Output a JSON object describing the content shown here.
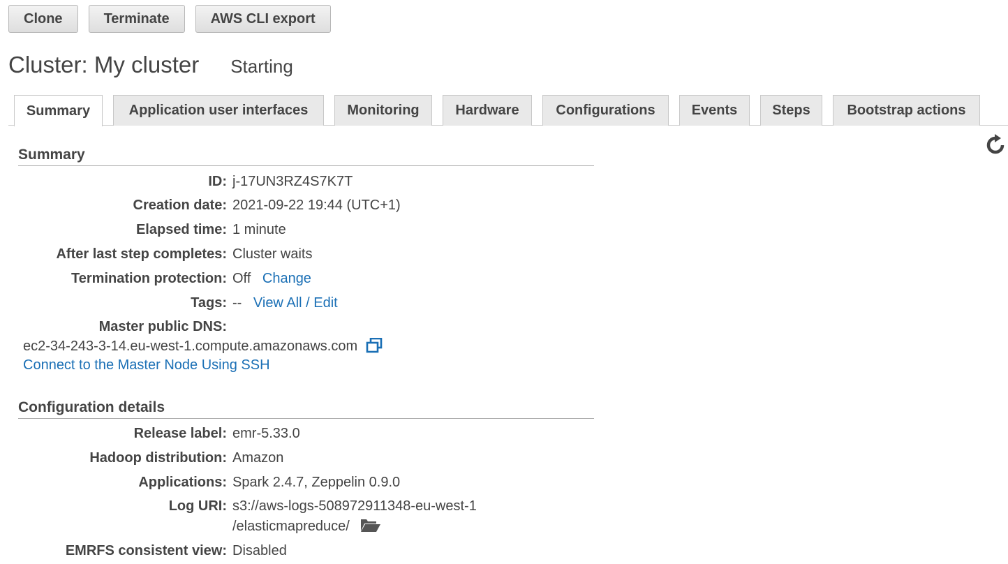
{
  "toolbar": {
    "clone": "Clone",
    "terminate": "Terminate",
    "cli_export": "AWS CLI export"
  },
  "cluster": {
    "title": "Cluster: My cluster",
    "status": "Starting"
  },
  "tabs": [
    {
      "label": "Summary",
      "active": true
    },
    {
      "label": "Application user interfaces",
      "active": false
    },
    {
      "label": "Monitoring",
      "active": false
    },
    {
      "label": "Hardware",
      "active": false
    },
    {
      "label": "Configurations",
      "active": false
    },
    {
      "label": "Events",
      "active": false
    },
    {
      "label": "Steps",
      "active": false
    },
    {
      "label": "Bootstrap actions",
      "active": false
    }
  ],
  "summary": {
    "title": "Summary",
    "id_label": "ID:",
    "id_value": "j-17UN3RZ4S7K7T",
    "created_label": "Creation date:",
    "created_value": "2021-09-22 19:44 (UTC+1)",
    "elapsed_label": "Elapsed time:",
    "elapsed_value": "1 minute",
    "after_label": "After last step completes:",
    "after_value": "Cluster waits",
    "term_label": "Termination protection:",
    "term_value": "Off",
    "term_link": "Change",
    "tags_label": "Tags:",
    "tags_value": "--",
    "tags_link": "View All / Edit",
    "dns_label": "Master public DNS:",
    "dns_value": "ec2-34-243-3-14.eu-west-1.compute.amazonaws.com",
    "ssh_link": "Connect to the Master Node Using SSH"
  },
  "config": {
    "title": "Configuration details",
    "release_label": "Release label:",
    "release_value": "emr-5.33.0",
    "hadoop_label": "Hadoop distribution:",
    "hadoop_value": "Amazon",
    "apps_label": "Applications:",
    "apps_value": "Spark 2.4.7, Zeppelin 0.9.0",
    "log_label": "Log URI:",
    "log_value_1": "s3://aws-logs-508972911348-eu-west-1",
    "log_value_2": "/elasticmapreduce/",
    "emrfs_label": "EMRFS consistent view:",
    "emrfs_value": "Disabled"
  },
  "icons": {
    "refresh": "refresh-icon",
    "copy": "copy-icon",
    "folder": "folder-open-icon"
  },
  "colors": {
    "link": "#1a6fb5",
    "tab_bg": "#e9e9e9"
  }
}
